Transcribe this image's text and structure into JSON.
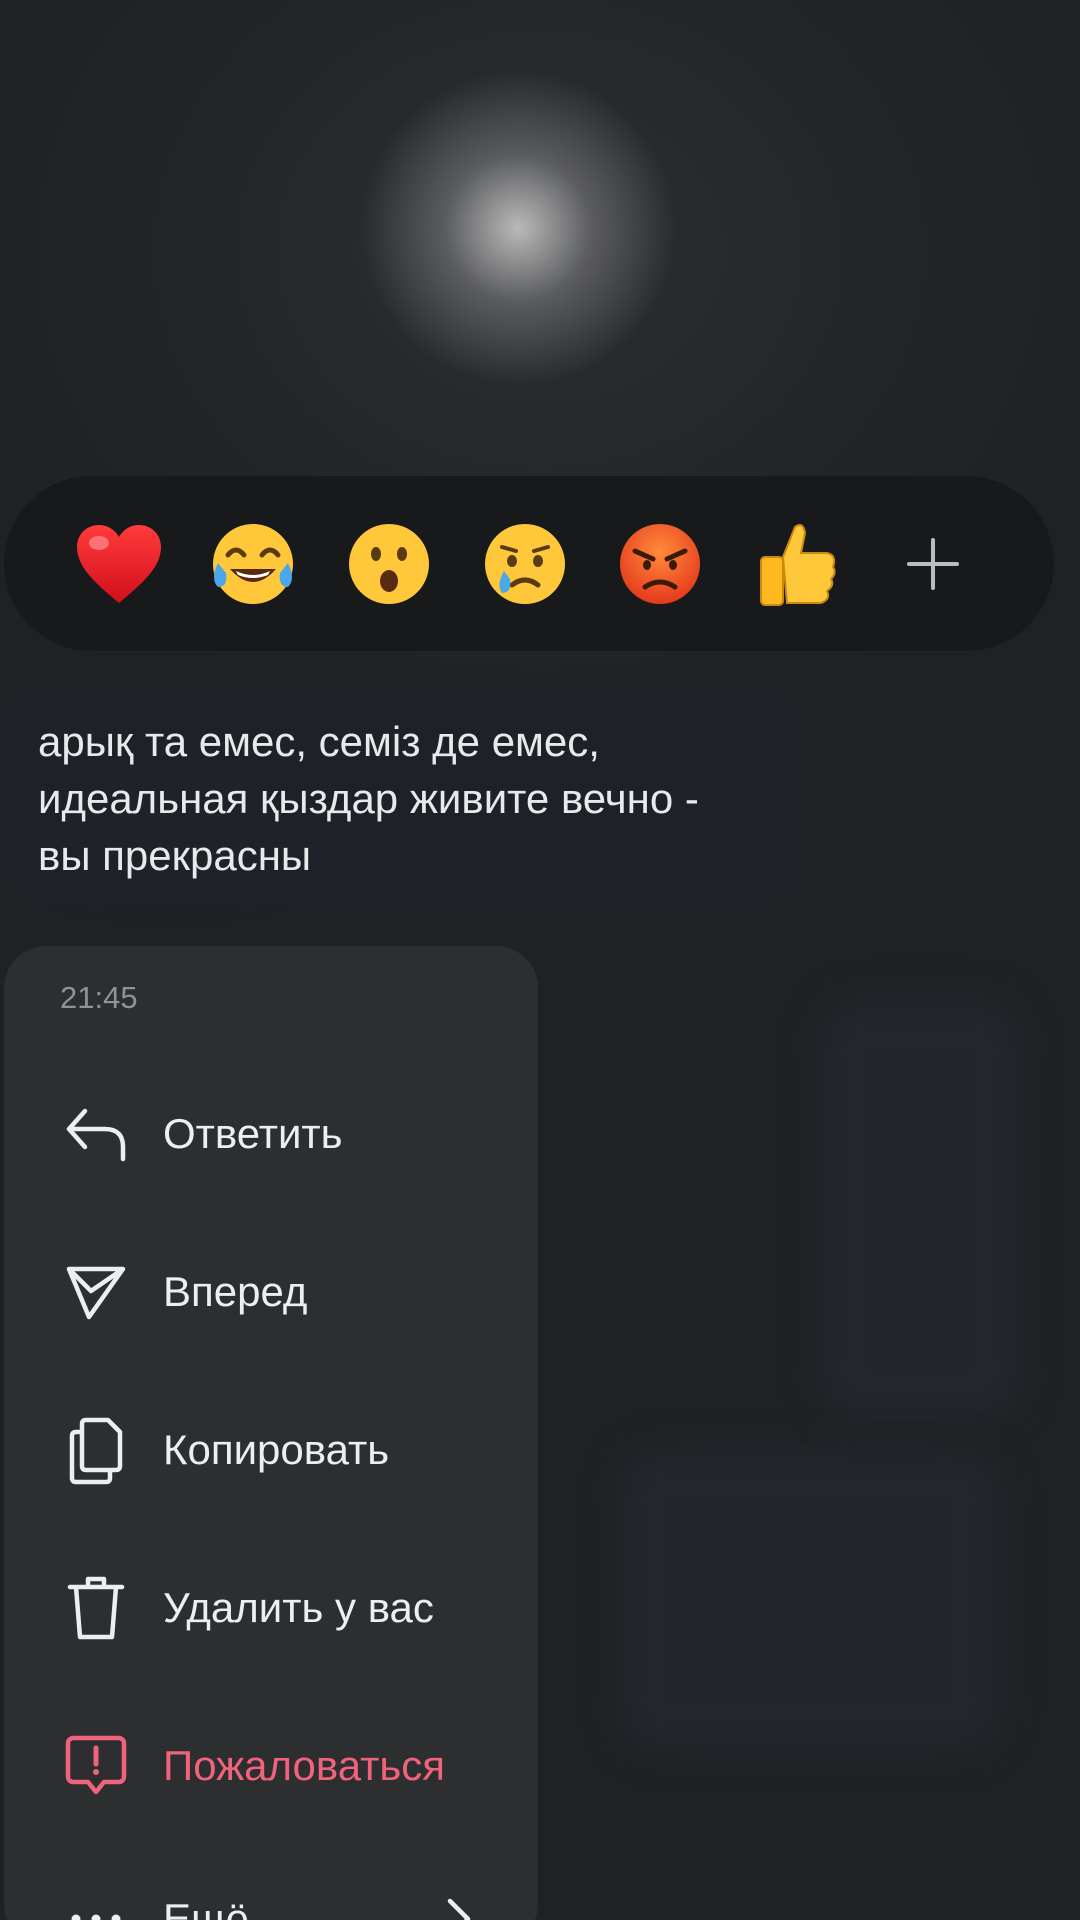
{
  "reactions": {
    "items": [
      {
        "emoji": "❤️",
        "name": "heart"
      },
      {
        "emoji": "😂",
        "name": "tears-of-joy"
      },
      {
        "emoji": "😮",
        "name": "surprised"
      },
      {
        "emoji": "😢",
        "name": "crying"
      },
      {
        "emoji": "😡",
        "name": "angry"
      },
      {
        "emoji": "👍",
        "name": "thumbs-up"
      }
    ],
    "more_icon": "plus-icon"
  },
  "message": {
    "lines": [
      "арық та емес, семіз де емес,",
      "идеальная қыздар живите вечно -",
      "вы прекрасны"
    ]
  },
  "menu": {
    "time": "21:45",
    "items": [
      {
        "label": "Ответить",
        "icon": "reply-icon"
      },
      {
        "label": "Вперед",
        "icon": "forward-icon"
      },
      {
        "label": "Копировать",
        "icon": "copy-icon"
      },
      {
        "label": "Удалить у вас",
        "icon": "trash-icon"
      },
      {
        "label": "Пожаловаться",
        "icon": "report-icon",
        "color": "#f0637a"
      }
    ],
    "more_label": "Ещё"
  },
  "colors": {
    "background": "#1f2124",
    "reaction_bar": "#17191b",
    "menu_background": "#2c2e30",
    "danger": "#f0637a"
  }
}
